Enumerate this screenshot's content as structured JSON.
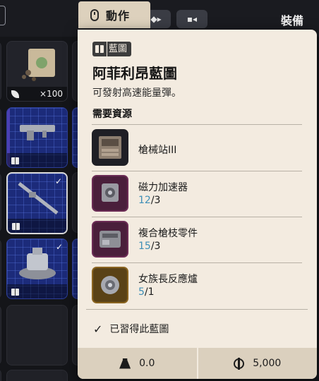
{
  "topbar": {
    "action_label": "動作",
    "equip_label": "裝備"
  },
  "inventory": {
    "slot1_qty": "×100"
  },
  "item": {
    "type_badge": "藍圖",
    "title": "阿菲利昂藍圖",
    "description": "可發射高速能量彈。",
    "requirements_heading": "需要資源",
    "requirements": [
      {
        "name": "槍械站III",
        "have": "",
        "sep": "",
        "need": "",
        "icon": "gun-workbench-icon",
        "rarity_color": "#1f1f25"
      },
      {
        "name": "磁力加速器",
        "have": "12",
        "sep": "/",
        "need": "3",
        "icon": "magnetic-accelerator-icon",
        "rarity_color": "#4a1f3b"
      },
      {
        "name": "複合槍枝零件",
        "have": "15",
        "sep": "/",
        "need": "3",
        "icon": "gun-parts-icon",
        "rarity_color": "#4a1f3b"
      },
      {
        "name": "女族長反應爐",
        "have": "5",
        "sep": "/",
        "need": "1",
        "icon": "reactor-icon",
        "rarity_color": "#5a4216"
      }
    ],
    "learned_text": "已習得此藍圖"
  },
  "footer": {
    "weight": "0.0",
    "price": "5,000"
  },
  "colors": {
    "panel_bg": "#f3ebe0",
    "accent_number": "#3f8fb7",
    "blueprint_slot": "#1c2b7a"
  }
}
